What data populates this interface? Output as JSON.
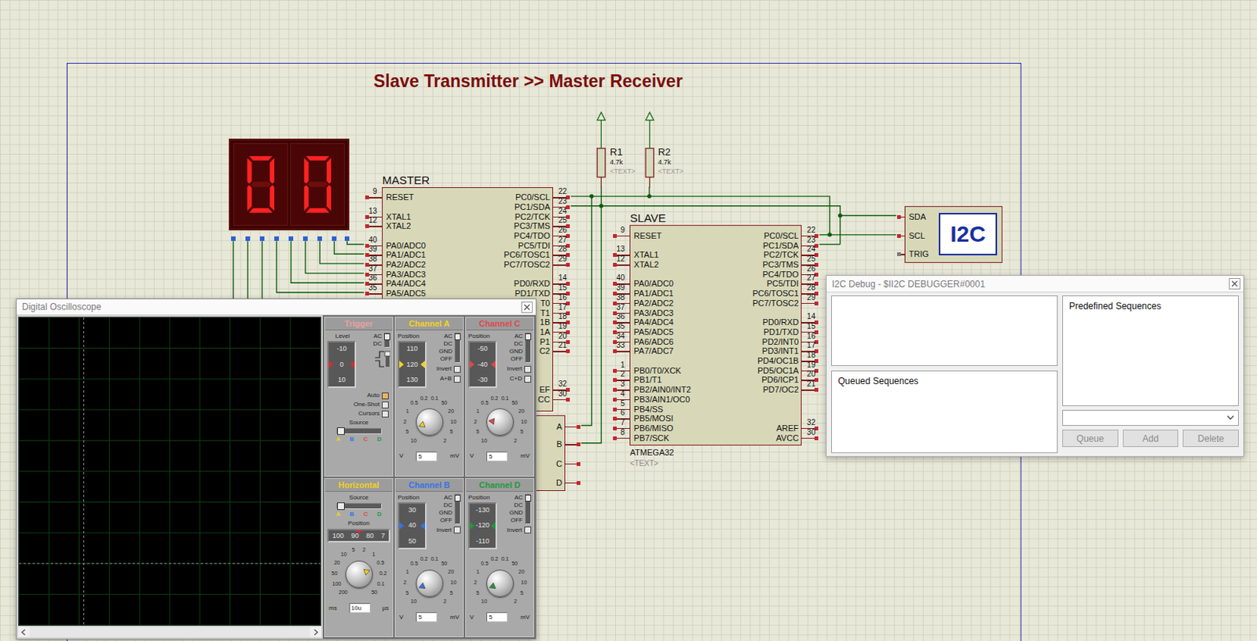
{
  "canvas": {
    "title": "Slave Transmitter >> Master Receiver"
  },
  "display": {
    "digits": [
      {
        "segments": {
          "a": true,
          "b": true,
          "c": true,
          "d": true,
          "e": true,
          "f": true,
          "g": false
        }
      },
      {
        "segments": {
          "a": true,
          "b": true,
          "c": true,
          "d": true,
          "e": true,
          "f": true,
          "g": false
        }
      }
    ]
  },
  "chips": [
    {
      "name": "MASTER",
      "left_pins": [
        {
          "label": "RESET",
          "number": "9"
        },
        {
          "label": "XTAL1",
          "number": "13"
        },
        {
          "label": "XTAL2",
          "number": "12"
        },
        {
          "label": "PA0/ADC0",
          "number": "40"
        },
        {
          "label": "PA1/ADC1",
          "number": "39"
        },
        {
          "label": "PA2/ADC2",
          "number": "38"
        },
        {
          "label": "PA3/ADC3",
          "number": "37"
        },
        {
          "label": "PA4/ADC4",
          "number": "36"
        },
        {
          "label": "PA5/ADC5",
          "number": "35"
        }
      ],
      "right_pins": [
        {
          "label": "PC0/SCL",
          "number": "22"
        },
        {
          "label": "PC1/SDA",
          "number": "23"
        },
        {
          "label": "PC2/TCK",
          "number": "24"
        },
        {
          "label": "PC3/TMS",
          "number": "25"
        },
        {
          "label": "PC4/TDO",
          "number": "26"
        },
        {
          "label": "PC5/TDI",
          "number": "27"
        },
        {
          "label": "PC6/TOSC1",
          "number": "28"
        },
        {
          "label": "PC7/TOSC2",
          "number": "29"
        },
        {
          "label": "PD0/RXD",
          "number": "14"
        },
        {
          "label": "PD1/TXD",
          "number": "15"
        },
        {
          "label": "T0",
          "number": "16"
        },
        {
          "label": "T1",
          "number": "17"
        },
        {
          "label": "1B",
          "number": "18"
        },
        {
          "label": "1A",
          "number": "19"
        },
        {
          "label": "P1",
          "number": "20"
        },
        {
          "label": "C2",
          "number": "21"
        },
        {
          "label": "EF",
          "number": "32"
        },
        {
          "label": "CC",
          "number": "30"
        }
      ]
    },
    {
      "name": "SLAVE",
      "part": "ATMEGA32",
      "text": "<TEXT>",
      "left_pins": [
        {
          "label": "RESET",
          "number": "9"
        },
        {
          "label": "XTAL1",
          "number": "13"
        },
        {
          "label": "XTAL2",
          "number": "12"
        },
        {
          "label": "PA0/ADC0",
          "number": "40"
        },
        {
          "label": "PA1/ADC1",
          "number": "39"
        },
        {
          "label": "PA2/ADC2",
          "number": "38"
        },
        {
          "label": "PA3/ADC3",
          "number": "37"
        },
        {
          "label": "PA4/ADC4",
          "number": "36"
        },
        {
          "label": "PA5/ADC5",
          "number": "35"
        },
        {
          "label": "PA6/ADC6",
          "number": "34"
        },
        {
          "label": "PA7/ADC7",
          "number": "33"
        },
        {
          "label": "PB0/T0/XCK",
          "number": "1"
        },
        {
          "label": "PB1/T1",
          "number": "2"
        },
        {
          "label": "PB2/AIN0/INT2",
          "number": "3"
        },
        {
          "label": "PB3/AIN1/OC0",
          "number": "4"
        },
        {
          "label": "PB4/SS",
          "number": "5"
        },
        {
          "label": "PB5/MOSI",
          "number": "6"
        },
        {
          "label": "PB6/MISO",
          "number": "7"
        },
        {
          "label": "PB7/SCK",
          "number": "8"
        }
      ],
      "right_pins": [
        {
          "label": "PC0/SCL",
          "number": "22"
        },
        {
          "label": "PC1/SDA",
          "number": "23"
        },
        {
          "label": "PC2/TCK",
          "number": "24"
        },
        {
          "label": "PC3/TMS",
          "number": "25"
        },
        {
          "label": "PC4/TDO",
          "number": "26"
        },
        {
          "label": "PC5/TDI",
          "number": "27"
        },
        {
          "label": "PC6/TOSC1",
          "number": "28"
        },
        {
          "label": "PC7/TOSC2",
          "number": "29"
        },
        {
          "label": "PD0/RXD",
          "number": "14"
        },
        {
          "label": "PD1/TXD",
          "number": "15"
        },
        {
          "label": "PD2/INT0",
          "number": "16"
        },
        {
          "label": "PD3/INT1",
          "number": "17"
        },
        {
          "label": "PD4/OC1B",
          "number": "18"
        },
        {
          "label": "PD5/OC1A",
          "number": "19"
        },
        {
          "label": "PD6/ICP1",
          "number": "20"
        },
        {
          "label": "PD7/OC2",
          "number": "21"
        },
        {
          "label": "AREF",
          "number": "32"
        },
        {
          "label": "AVCC",
          "number": "30"
        }
      ]
    }
  ],
  "resistors": [
    {
      "name": "R1",
      "value": "4.7k",
      "text": "<TEXT>"
    },
    {
      "name": "R2",
      "value": "4.7k",
      "text": "<TEXT>"
    }
  ],
  "i2c_symbol": {
    "logo": "I2C",
    "pins": [
      {
        "label": "SDA",
        "connected": true
      },
      {
        "label": "SCL",
        "connected": true
      },
      {
        "label": "TRIG",
        "connected": false
      }
    ]
  },
  "scope_symbol": {
    "pins": [
      "A",
      "B",
      "C",
      "D"
    ]
  },
  "oscilloscope": {
    "title": "Digital Oscilloscope",
    "trigger": {
      "title": "Trigger",
      "color": "#eaa0a0",
      "level_label": "Level",
      "scale": [
        "-10",
        "0",
        "10"
      ],
      "coupling": [
        {
          "label": "AC",
          "selected": true
        },
        {
          "label": "DC",
          "selected": false
        }
      ],
      "options": [
        {
          "label": "Auto",
          "checked": true
        },
        {
          "label": "One-Shot",
          "checked": false
        },
        {
          "label": "Cursors",
          "checked": false
        }
      ],
      "source_label": "Source",
      "sources": [
        {
          "label": "A",
          "color": "#f3d21c",
          "selected": true
        },
        {
          "label": "B",
          "color": "#3574e6",
          "selected": false
        },
        {
          "label": "C",
          "color": "#e0484a",
          "selected": false
        },
        {
          "label": "D",
          "color": "#1f9a3c",
          "selected": false
        }
      ]
    },
    "horizontal": {
      "title": "Horizontal",
      "color": "#f3d21c",
      "source_label": "Source",
      "sources": [
        {
          "label": "A",
          "color": "#f3d21c",
          "selected": true
        },
        {
          "label": "B",
          "color": "#3574e6",
          "selected": false
        },
        {
          "label": "C",
          "color": "#e0484a",
          "selected": false
        },
        {
          "label": "D",
          "color": "#1f9a3c",
          "selected": false
        }
      ],
      "position_label": "Position",
      "scale": [
        "100",
        "90",
        "80",
        "7"
      ],
      "knob": {
        "ticks": [
          "200",
          "100",
          "50",
          "20",
          "10",
          "5",
          "2",
          "1",
          "0.5",
          "0.2",
          "0.1",
          "50"
        ],
        "level": 0.75
      },
      "unit_left": "ms",
      "value": "10u",
      "unit_right": "µs"
    },
    "channels": [
      {
        "title": "Channel A",
        "color": "#f3d21c",
        "position_label": "Position",
        "scale": [
          "110",
          "120",
          "130"
        ],
        "modes": [
          {
            "label": "AC",
            "selected": true
          },
          {
            "label": "DC",
            "selected": false
          },
          {
            "label": "GND",
            "selected": false
          },
          {
            "label": "OFF",
            "selected": false
          }
        ],
        "invert": {
          "label": "Invert",
          "checked": false
        },
        "combine": {
          "label": "A+B",
          "checked": false
        },
        "knob": {
          "ticks": [
            "10",
            "5",
            "2",
            "1",
            "0.5",
            "0.2",
            "0.1",
            "50",
            "20",
            "10",
            "5",
            "2"
          ],
          "level": 0.1
        },
        "unit_left": "V",
        "value": "5",
        "unit_right": "mV"
      },
      {
        "title": "Channel B",
        "color": "#3574e6",
        "position_label": "Position",
        "scale": [
          "30",
          "40",
          "50"
        ],
        "modes": [
          {
            "label": "AC",
            "selected": true
          },
          {
            "label": "DC",
            "selected": false
          },
          {
            "label": "GND",
            "selected": false
          },
          {
            "label": "OFF",
            "selected": false
          }
        ],
        "invert": {
          "label": "Invert",
          "checked": false
        },
        "knob": {
          "ticks": [
            "10",
            "5",
            "2",
            "1",
            "0.5",
            "0.2",
            "0.1",
            "50",
            "20",
            "10",
            "5",
            "2"
          ],
          "level": 0.1
        },
        "unit_left": "V",
        "value": "5",
        "unit_right": "mV"
      },
      {
        "title": "Channel C",
        "color": "#e0484a",
        "position_label": "Position",
        "scale": [
          "-50",
          "-40",
          "-30"
        ],
        "modes": [
          {
            "label": "AC",
            "selected": true
          },
          {
            "label": "DC",
            "selected": false
          },
          {
            "label": "GND",
            "selected": false
          },
          {
            "label": "OFF",
            "selected": false
          }
        ],
        "invert": {
          "label": "Invert",
          "checked": false
        },
        "combine": {
          "label": "C+D",
          "checked": false
        },
        "knob": {
          "ticks": [
            "10",
            "5",
            "2",
            "1",
            "0.5",
            "0.2",
            "0.1",
            "50",
            "20",
            "10",
            "5",
            "2"
          ],
          "level": 0.2
        },
        "unit_left": "V",
        "value": "5",
        "unit_right": "mV"
      },
      {
        "title": "Channel D",
        "color": "#1f9a3c",
        "position_label": "Position",
        "scale": [
          "-130",
          "-120",
          "-110"
        ],
        "modes": [
          {
            "label": "AC",
            "selected": true
          },
          {
            "label": "DC",
            "selected": false
          },
          {
            "label": "GND",
            "selected": false
          },
          {
            "label": "OFF",
            "selected": false
          }
        ],
        "invert": {
          "label": "Invert",
          "checked": false
        },
        "knob": {
          "ticks": [
            "10",
            "5",
            "2",
            "1",
            "0.5",
            "0.2",
            "0.1",
            "50",
            "20",
            "10",
            "5",
            "2"
          ],
          "level": 0.1
        },
        "unit_left": "V",
        "value": "5",
        "unit_right": "mV"
      }
    ]
  },
  "i2c_debug": {
    "title": "I2C Debug - $II2C DEBUGGER#0001",
    "queued_label": "Queued Sequences",
    "predefined_label": "Predefined Sequences",
    "buttons": [
      {
        "label": "Queue",
        "disabled": true
      },
      {
        "label": "Add",
        "disabled": true
      },
      {
        "label": "Delete",
        "disabled": true
      }
    ]
  }
}
